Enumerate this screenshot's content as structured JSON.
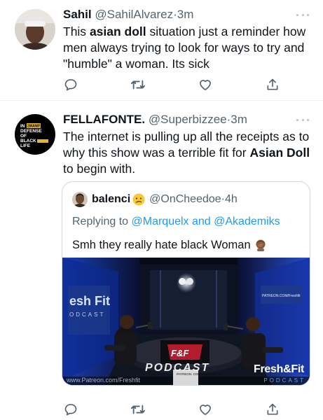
{
  "tweets": [
    {
      "display_name": "Sahil",
      "handle": "@SahilAlvarez",
      "separator": "·",
      "time": "3m",
      "text_1": "This ",
      "text_bold_1": "asian doll",
      "text_2": " situation just a reminder how men always trying to look for ways to try and \"humble\" a woman. Its sick"
    },
    {
      "display_name": "FELLAFONTE.",
      "handle": "@Superbizzee",
      "separator": "·",
      "time": "3m",
      "text_1": "The internet is pulling up all the receipts as to why this show was a terrible fit for ",
      "text_bold_1": "Asian Doll",
      "text_2": " to begin with.",
      "avatar_text": [
        "IN",
        "DEFENSE",
        "OF",
        "BLACK",
        "LIFE"
      ],
      "avatar_badge": "2MANIF",
      "quoted": {
        "display_name": "balenci",
        "handle": "@OnCheedoe",
        "separator": "·",
        "time": "4h",
        "replying_prefix": "Replying to ",
        "mention_1": "@Marquelx",
        "replying_and": " and ",
        "mention_2": "@Akademiks",
        "text": "Smh they really hate black Woman",
        "media": {
          "left_sign": "esh Fit",
          "left_sign_sub": "ODCAST",
          "table_label": "PODCAST",
          "patreon_sign": "PATREON. COM/ FRESHFIT",
          "right_sign": "PATREON.COM/Freshfit",
          "url": "www.Patreon.com/Freshfit",
          "brand": "Fresh&Fit",
          "brand_sub": "PODCAST"
        }
      }
    }
  ],
  "icons": [
    "reply-icon",
    "retweet-icon",
    "like-icon",
    "share-icon",
    "more-icon"
  ],
  "colors": {
    "text": "#0f1419",
    "secondary": "#536471",
    "link": "#1d9bf0",
    "border": "#cfd9de",
    "divider": "#eff3f4"
  }
}
